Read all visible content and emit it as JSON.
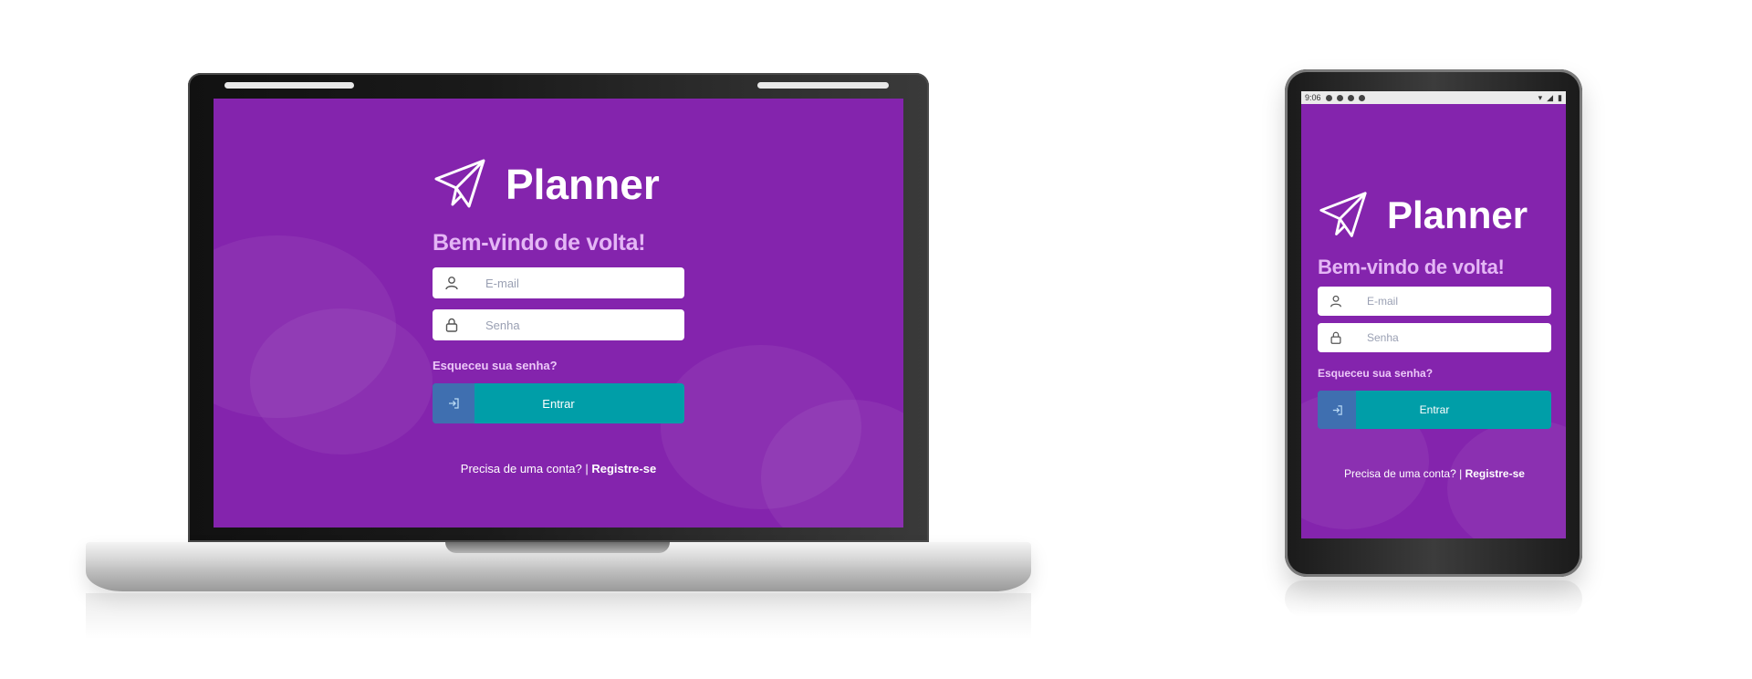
{
  "app": {
    "title": "Planner",
    "welcome": "Bem-vindo de volta!",
    "email_placeholder": "E-mail",
    "password_placeholder": "Senha",
    "forgot_password": "Esqueceu sua senha?",
    "enter_label": "Entrar",
    "signup_prompt": "Precisa de uma conta? |",
    "signup_link": "Registre-se"
  },
  "phone_status": {
    "time": "9:06"
  },
  "colors": {
    "background": "#8424ad",
    "welcome_text": "#e4b6f5",
    "enter_button": "#009ea8",
    "enter_icon_box": "#3f6fb0"
  },
  "icons": {
    "logo": "paper-plane-icon",
    "email": "user-icon",
    "password": "lock-icon",
    "enter": "login-arrow-icon"
  }
}
